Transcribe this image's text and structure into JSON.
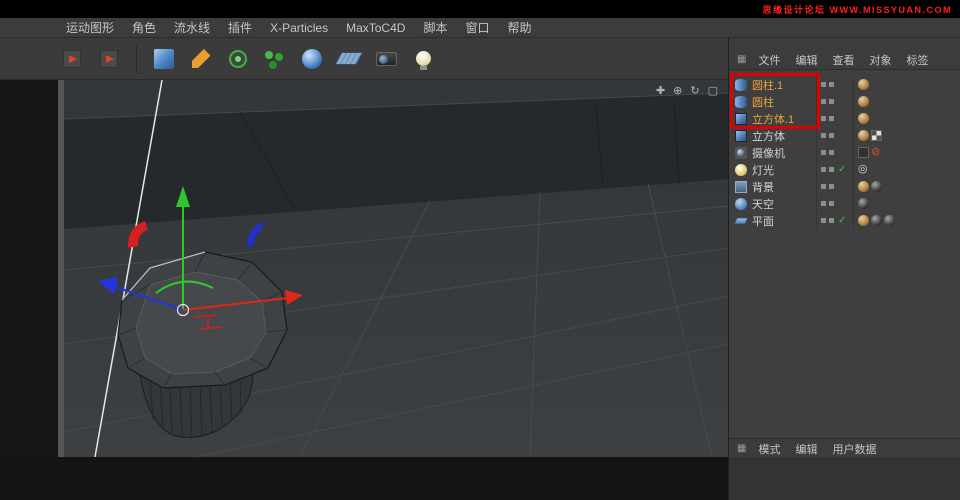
{
  "colors": {
    "annotation": "#e10000",
    "selected_label": "#e8a43c",
    "label": "#d2d2d2",
    "watermark": "#ff1f1f"
  },
  "watermark": {
    "text": "思缘设计论坛 WWW.MISSYUAN.COM"
  },
  "menubar": {
    "items": [
      "运动图形",
      "角色",
      "流水线",
      "插件",
      "X-Particles",
      "MaxToC4D",
      "脚本",
      "窗口",
      "帮助"
    ]
  },
  "toolbar": {
    "icons": [
      "nav-back",
      "nav-forward",
      "|",
      "cube-primitive",
      "spline-pen",
      "mograph",
      "cloner",
      "deformer-sphere",
      "floor-plane",
      "camera",
      "light"
    ]
  },
  "viewport": {
    "nav_icons": [
      {
        "name": "pan-view-icon",
        "glyph": "✚"
      },
      {
        "name": "zoom-view-icon",
        "glyph": "⊕"
      },
      {
        "name": "rotate-view-icon",
        "glyph": "↻"
      },
      {
        "name": "maximize-view-icon",
        "glyph": "▢"
      }
    ]
  },
  "object_manager": {
    "grid_icon": "▦",
    "menu": [
      "文件",
      "编辑",
      "查看",
      "对象",
      "标签"
    ],
    "items": [
      {
        "label": "圆柱.1",
        "icon": "cylinder",
        "selected": true,
        "tags": [
          "phong"
        ]
      },
      {
        "label": "圆柱",
        "icon": "cylinder",
        "selected": true,
        "tags": [
          "phong"
        ]
      },
      {
        "label": "立方体.1",
        "icon": "cube",
        "selected": true,
        "tags": [
          "phong"
        ]
      },
      {
        "label": "立方体",
        "icon": "cube",
        "selected": false,
        "tags": [
          "phong",
          "checker"
        ]
      },
      {
        "label": "摄像机",
        "icon": "camera",
        "selected": false,
        "tags": [
          "film",
          "slash"
        ]
      },
      {
        "label": "灯光",
        "icon": "light",
        "selected": false,
        "enabled": true,
        "tags": [
          "target"
        ]
      },
      {
        "label": "背景",
        "icon": "background",
        "selected": false,
        "tags": [
          "phong",
          "sphere"
        ]
      },
      {
        "label": "天空",
        "icon": "sky",
        "selected": false,
        "tags": [
          "sphere"
        ]
      },
      {
        "label": "平面",
        "icon": "plane",
        "selected": false,
        "enabled": true,
        "tags": [
          "phong",
          "sphere",
          "sphere"
        ]
      }
    ]
  },
  "bottom_bar": {
    "grid_icon": "▦",
    "menu": [
      "模式",
      "编辑",
      "用户数据"
    ]
  }
}
